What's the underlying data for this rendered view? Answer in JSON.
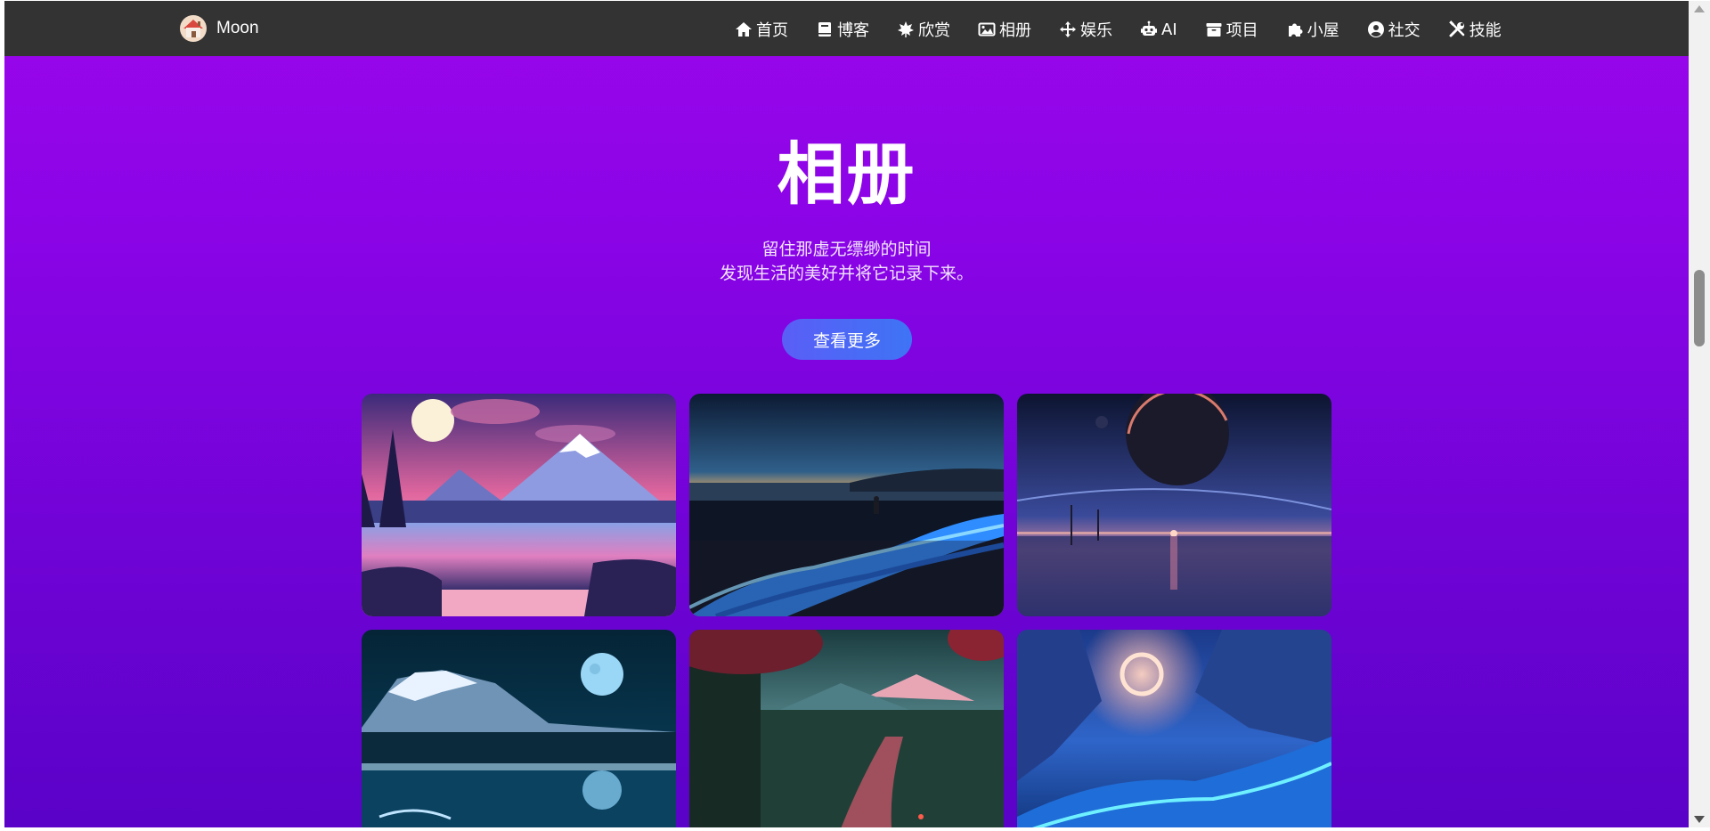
{
  "brand": {
    "name": "Moon",
    "logo_icon": "house-icon"
  },
  "nav": {
    "items": [
      {
        "label": "首页",
        "icon": "home-icon"
      },
      {
        "label": "博客",
        "icon": "book-icon"
      },
      {
        "label": "欣赏",
        "icon": "leaf-icon"
      },
      {
        "label": "相册",
        "icon": "image-icon"
      },
      {
        "label": "娱乐",
        "icon": "arrows-icon"
      },
      {
        "label": "AI",
        "icon": "robot-icon"
      },
      {
        "label": "项目",
        "icon": "archive-icon"
      },
      {
        "label": "小屋",
        "icon": "puzzle-icon"
      },
      {
        "label": "社交",
        "icon": "user-circle-icon"
      },
      {
        "label": "技能",
        "icon": "tools-icon"
      }
    ]
  },
  "hero": {
    "title": "相册",
    "subtitle_line1": "留住那虚无缥缈的时间",
    "subtitle_line2": "发现生活的美好并将它记录下来。",
    "button_label": "查看更多"
  },
  "gallery": {
    "photos": [
      {
        "name": "moon-mountain-lake"
      },
      {
        "name": "glowing-shore-girl"
      },
      {
        "name": "planet-horizon-sea"
      },
      {
        "name": "snowy-mountain-full-moon"
      },
      {
        "name": "village-river-lanterns"
      },
      {
        "name": "glowing-ring-icy-cliffs"
      }
    ]
  },
  "colors": {
    "navbar_bg": "#333333",
    "hero_gradient_top": "#9b06ec",
    "hero_gradient_bottom": "#5a02c8",
    "button_gradient": [
      "#5a5ef6",
      "#3e74f5"
    ]
  }
}
